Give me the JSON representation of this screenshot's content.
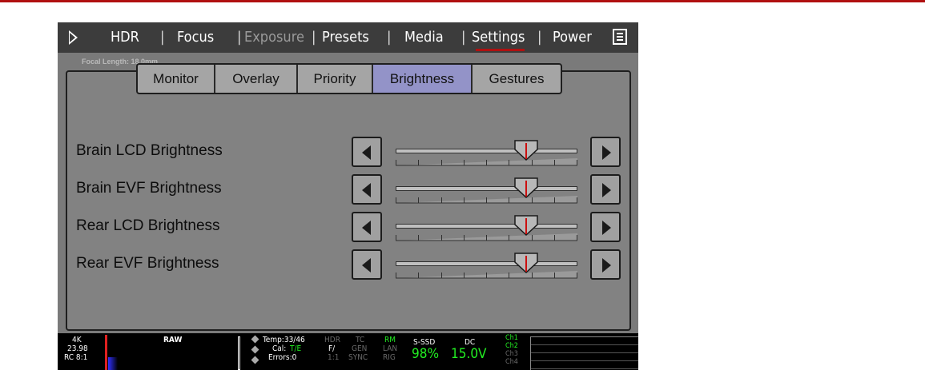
{
  "menu": {
    "items": [
      {
        "label": "HDR",
        "state": "normal"
      },
      {
        "label": "Focus",
        "state": "normal"
      },
      {
        "label": "Exposure",
        "state": "disabled"
      },
      {
        "label": "Presets",
        "state": "normal"
      },
      {
        "label": "Media",
        "state": "normal"
      },
      {
        "label": "Settings",
        "state": "selected"
      },
      {
        "label": "Power",
        "state": "normal"
      }
    ],
    "separator": "|",
    "icons": {
      "left": "play-triangle-icon",
      "right": "menu-list-icon"
    }
  },
  "background_text": "Focal Length: 18.0mm",
  "tabs": [
    {
      "label": "Monitor",
      "active": false
    },
    {
      "label": "Overlay",
      "active": false
    },
    {
      "label": "Priority",
      "active": false
    },
    {
      "label": "Brightness",
      "active": true
    },
    {
      "label": "Gestures",
      "active": false
    }
  ],
  "settings": [
    {
      "label": "Brain LCD Brightness",
      "level": 0.72
    },
    {
      "label": "Brain EVF Brightness",
      "level": 0.72
    },
    {
      "label": "Rear LCD Brightness",
      "level": 0.72
    },
    {
      "label": "Rear EVF Brightness",
      "level": 0.72
    }
  ],
  "status": {
    "resolution": "4K",
    "fps": "23.98",
    "compression": "RC 8:1",
    "format": "RAW",
    "temp": "Temp:33/46",
    "cal_label": "Cal:",
    "cal_value": "T/E",
    "errors": "Errors:0",
    "hdr": "HDR",
    "f_ratio": "F/",
    "ratio": "1:1",
    "tc": "TC",
    "gen": "GEN",
    "sync": "SYNC",
    "rm": "RM",
    "lan": "LAN",
    "rig": "RIG",
    "media_label": "S-SSD",
    "media_value": "98%",
    "power_label": "DC",
    "power_value": "15.0V",
    "audio_channels": [
      "Ch1",
      "Ch2",
      "Ch3",
      "Ch4"
    ]
  },
  "colors": {
    "accent_red": "#b01010",
    "active_tab": "#9393c8",
    "status_green": "#22ee22"
  }
}
